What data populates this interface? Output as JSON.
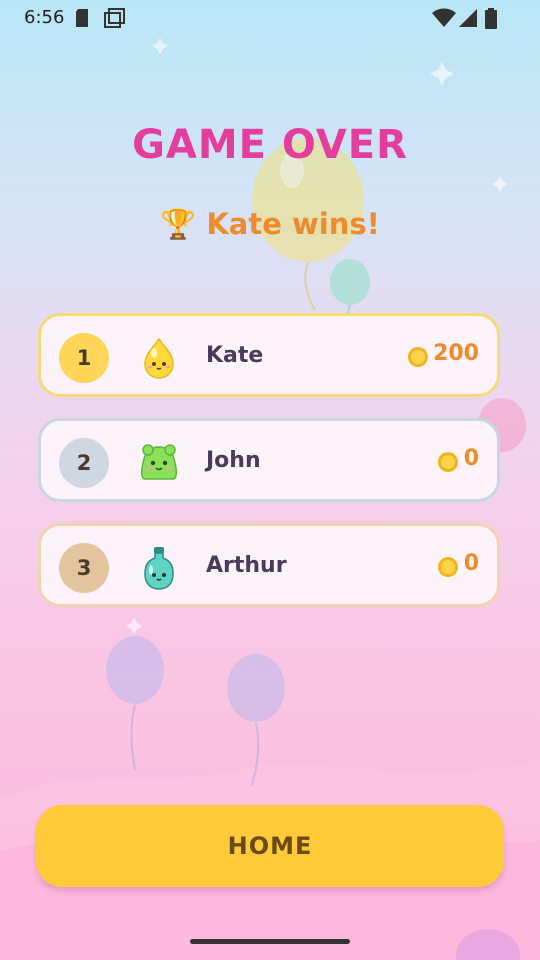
{
  "status_bar": {
    "time": "6:56"
  },
  "title": "GAME OVER",
  "subtitle": {
    "trophy": "🏆",
    "text": "Kate wins!"
  },
  "players": [
    {
      "rank": "1",
      "name": "Kate",
      "score": "200",
      "avatar": "yellow-drop-character",
      "badge_color": "#ffd65a"
    },
    {
      "rank": "2",
      "name": "John",
      "score": "0",
      "avatar": "green-slime-character",
      "badge_color": "#cfd8e2"
    },
    {
      "rank": "3",
      "name": "Arthur",
      "score": "0",
      "avatar": "teal-bottle-character",
      "badge_color": "#e4c49e"
    }
  ],
  "home_button": {
    "label": "HOME"
  },
  "colors": {
    "title": "#e43d9d",
    "subtitle": "#ef8b29",
    "button": "#ffca3a",
    "score": "#ef8b29"
  }
}
